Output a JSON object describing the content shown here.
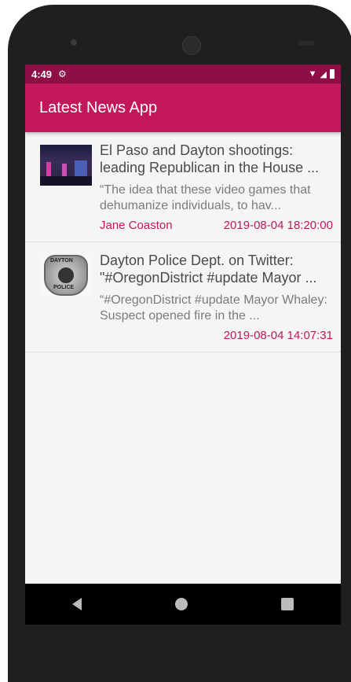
{
  "status_bar": {
    "time": "4:49"
  },
  "app_bar": {
    "title": "Latest News App"
  },
  "articles": [
    {
      "title": "El Paso and Dayton shootings: leading Republican in the House ...",
      "description": "“The idea that these video games that dehumanize individuals, to hav...",
      "author": "Jane Coaston",
      "date": "2019-08-04 18:20:00"
    },
    {
      "title": "Dayton Police Dept. on Twitter: \"#OregonDistrict #update Mayor ...",
      "description": "“#OregonDistrict #update Mayor Whaley: Suspect opened fire in the ...",
      "author": "",
      "date": "2019-08-04 14:07:31",
      "badge_text_top": "DAYTON",
      "badge_text_bottom": "POLICE"
    }
  ],
  "colors": {
    "primary": "#c2185b",
    "primary_dark": "#8e0e45",
    "accent": "#c2185b"
  }
}
